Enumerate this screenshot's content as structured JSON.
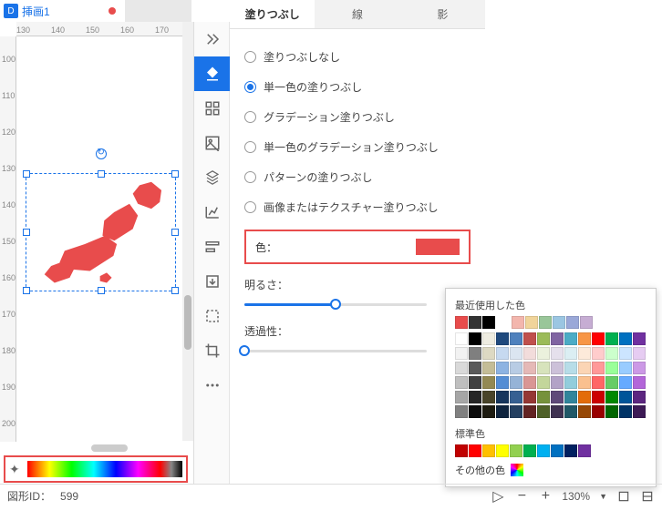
{
  "tab": {
    "icon": "D",
    "label": "挿画1"
  },
  "ruler_h": [
    "130",
    "140",
    "150",
    "160",
    "170"
  ],
  "ruler_v": [
    "100",
    "110",
    "120",
    "130",
    "140",
    "150",
    "160",
    "170",
    "180",
    "190",
    "200"
  ],
  "status": {
    "shape_id_label": "図形ID：",
    "shape_id": "599",
    "zoom": "130%"
  },
  "side_icons": [
    "collapse",
    "fill",
    "grid",
    "image",
    "layers",
    "chart",
    "align",
    "export",
    "outline",
    "crop",
    "more"
  ],
  "props": {
    "tabs": {
      "fill": "塗りつぶし",
      "line": "線",
      "shadow": "影"
    },
    "fill_options": {
      "none": "塗りつぶしなし",
      "solid": "単一色の塗りつぶし",
      "gradient": "グラデーション塗りつぶし",
      "solid_gradient": "単一色のグラデーション塗りつぶし",
      "pattern": "パターンの塗りつぶし",
      "texture": "画像またはテクスチャー塗りつぶし"
    },
    "color_label": "色：",
    "color_value": "#e84c4c",
    "brightness_label": "明るさ：",
    "brightness_value": 50,
    "opacity_label": "透過性：",
    "opacity_value": 0
  },
  "color_picker": {
    "recent_label": "最近使用した色",
    "recent": [
      "#e84c4c",
      "#333333",
      "#000000"
    ],
    "recent_extra": [
      "#f3b6ad",
      "#f0d49a",
      "#99c699",
      "#9bc6e2",
      "#9aa8d8",
      "#c6add3"
    ],
    "standard_label": "標準色",
    "standard": [
      "#c00000",
      "#ff0000",
      "#ffc000",
      "#ffff00",
      "#92d050",
      "#00b050",
      "#00b0f0",
      "#0070c0",
      "#002060",
      "#7030a0"
    ],
    "other_label": "その他の色",
    "grid_cols": [
      [
        "#ffffff",
        "#f2f2f2",
        "#d9d9d9",
        "#bfbfbf",
        "#a6a6a6",
        "#808080"
      ],
      [
        "#000000",
        "#7f7f7f",
        "#595959",
        "#404040",
        "#262626",
        "#0d0d0d"
      ],
      [
        "#eeece1",
        "#ddd9c3",
        "#c4bd97",
        "#938953",
        "#494429",
        "#1d1b10"
      ],
      [
        "#1f497d",
        "#c6d9f0",
        "#8db3e2",
        "#548dd4",
        "#17365d",
        "#0f243e"
      ],
      [
        "#4f81bd",
        "#dbe5f1",
        "#b8cce4",
        "#95b3d7",
        "#366092",
        "#244061"
      ],
      [
        "#c0504d",
        "#f2dcdb",
        "#e5b9b7",
        "#d99694",
        "#953734",
        "#632423"
      ],
      [
        "#9bbb59",
        "#ebf1dd",
        "#d7e3bc",
        "#c3d69b",
        "#76923c",
        "#4f6128"
      ],
      [
        "#8064a2",
        "#e5e0ec",
        "#ccc1d9",
        "#b2a2c7",
        "#5f497a",
        "#3f3151"
      ],
      [
        "#4bacc6",
        "#dbeef3",
        "#b7dde8",
        "#92cddc",
        "#31859b",
        "#205867"
      ],
      [
        "#f79646",
        "#fdeada",
        "#fbd5b5",
        "#fac08f",
        "#e36c09",
        "#974806"
      ],
      [
        "#ff0000",
        "#ffcccc",
        "#ff9999",
        "#ff6666",
        "#cc0000",
        "#990000"
      ],
      [
        "#00b050",
        "#ccffcc",
        "#99ff99",
        "#66cc66",
        "#008800",
        "#006600"
      ],
      [
        "#0070c0",
        "#cce5ff",
        "#99ccff",
        "#66aaff",
        "#005599",
        "#003366"
      ],
      [
        "#7030a0",
        "#e6ccf2",
        "#cc99e6",
        "#b366d9",
        "#5c2680",
        "#3d1a55"
      ]
    ]
  }
}
